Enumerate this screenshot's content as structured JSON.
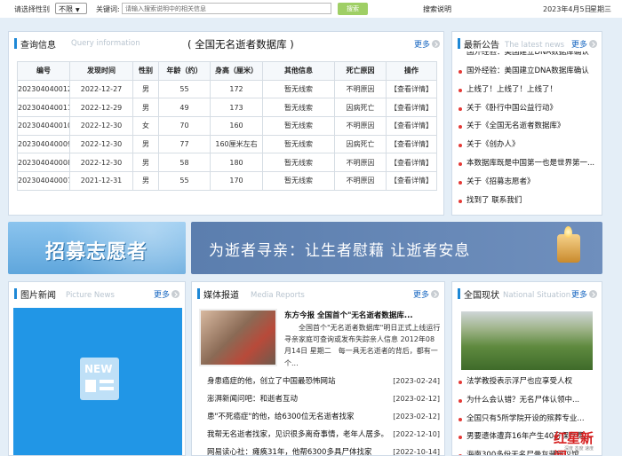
{
  "topbar": {
    "gender_label": "请选择性别",
    "gender_value": "不限",
    "keyword_label": "关键词:",
    "keyword_placeholder": "请输入搜索说明中的相关信息",
    "search_button": "搜索",
    "search_help": "搜索说明",
    "date": "2023年4月5日",
    "weekday": "星期三"
  },
  "query": {
    "title": "查询信息",
    "subtitle": "Query information",
    "db_title": "( 全国无名逝者数据库 )",
    "more": "更多",
    "headers": [
      "编号",
      "发现时间",
      "性别",
      "年龄（约）",
      "身高（厘米）",
      "其他信息",
      "死亡原因",
      "操作"
    ],
    "rows": [
      [
        "202304040012",
        "2022-12-27",
        "男",
        "55",
        "172",
        "暂无线索",
        "不明原因",
        "【查看详情】"
      ],
      [
        "202304040011",
        "2022-12-29",
        "男",
        "49",
        "173",
        "暂无线索",
        "因病死亡",
        "【查看详情】"
      ],
      [
        "202304040010",
        "2022-12-30",
        "女",
        "70",
        "160",
        "暂无线索",
        "不明原因",
        "【查看详情】"
      ],
      [
        "202304040009",
        "2022-12-30",
        "男",
        "77",
        "160厘米左右",
        "暂无线索",
        "因病死亡",
        "【查看详情】"
      ],
      [
        "202304040008",
        "2022-12-30",
        "男",
        "58",
        "180",
        "暂无线索",
        "不明原因",
        "【查看详情】"
      ],
      [
        "202304040007",
        "2021-12-31",
        "男",
        "55",
        "170",
        "暂无线索",
        "不明原因",
        "【查看详情】"
      ]
    ]
  },
  "notice": {
    "title": "最新公告",
    "subtitle": "The latest news",
    "more": "更多",
    "items": [
      "国外经验：美国建立DNA数据库确认",
      "上线了！上线了！上线了！",
      "关于《卧行中国公益行动》",
      "关于《全国无名逝者数据库》",
      "关于《创办人》",
      "本数据库既是中国第一也是世界第一...",
      "关于《招募志愿者》",
      "找到了 联系我们"
    ],
    "clipped_text": "国外经验：美国建立DNA数据库确认"
  },
  "banners": {
    "volunteer": "招募志愿者",
    "slogan": "为逝者寻亲：让生者慰藉 让逝者安息"
  },
  "picture_news": {
    "title": "图片新闻",
    "subtitle": "Picture News",
    "more": "更多",
    "placeholder": "NEW"
  },
  "media": {
    "title": "媒体报道",
    "subtitle": "Media Reports",
    "more": "更多",
    "headline": "东方今报 全国首个\"无名逝者数据库...",
    "summary": "全国首个\"无名逝者数据库\"明日正式上线运行 寻亲家庭可查询或发布失踪亲人信息 2012年08月14日 星期二　每一具无名逝者的背后，都有一个...",
    "items": [
      {
        "t": "身患癌症的他，创立了中国最恐怖网站",
        "d": "[2023-02-24]"
      },
      {
        "t": "澎湃新闻问吧：和逝者互动",
        "d": "[2023-02-12]"
      },
      {
        "t": "患\"不死癌症\"的他，给6300位无名逝者找家",
        "d": "[2023-02-12]"
      },
      {
        "t": "我帮无名逝者找家，见识很多离奇事情，老年人居多。",
        "d": "[2022-12-10]"
      },
      {
        "t": "网易读心社：瘫痪31年，他帮6300多具尸体找家",
        "d": "[2022-10-14]"
      }
    ]
  },
  "national": {
    "title": "全国现状",
    "subtitle": "National Situation",
    "more": "更多",
    "items": [
      "法学教授表示浮尸也应享受人权",
      "为什么会认错？无名尸体认领中...",
      "全国只有5所学院开设的殡葬专业...",
      "男要遗体遭弃16年产生40万保存费...",
      "海南300多份无名尸骨灰藏殡仪馆..."
    ]
  },
  "watermark": {
    "brand": "红星新闻",
    "sub": "深度 态度 速度"
  }
}
